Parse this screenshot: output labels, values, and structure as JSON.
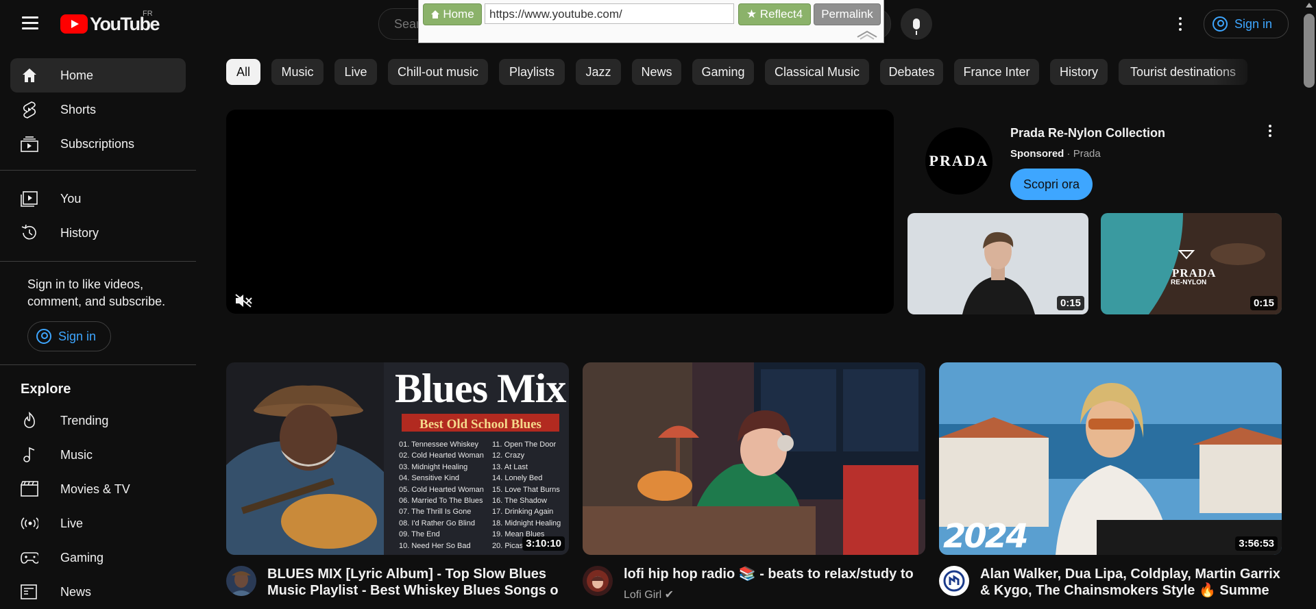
{
  "header": {
    "logo_text": "YouTube",
    "region": "FR",
    "search_placeholder": "Search",
    "signin_label": "Sign in"
  },
  "bookmarklet": {
    "home_label": "Home",
    "url_value": "https://www.youtube.com/",
    "reflect_label": "★ Reflect4",
    "permalink_label": "Permalink"
  },
  "sidebar": {
    "items": [
      {
        "label": "Home",
        "icon": "home-icon"
      },
      {
        "label": "Shorts",
        "icon": "shorts-icon"
      },
      {
        "label": "Subscriptions",
        "icon": "subscriptions-icon"
      },
      {
        "label": "You",
        "icon": "you-icon"
      },
      {
        "label": "History",
        "icon": "history-icon"
      }
    ],
    "signin_message": "Sign in to like videos, comment, and subscribe.",
    "signin_label": "Sign in",
    "explore_title": "Explore",
    "explore": [
      {
        "label": "Trending",
        "icon": "trending-icon"
      },
      {
        "label": "Music",
        "icon": "music-icon"
      },
      {
        "label": "Movies & TV",
        "icon": "movies-icon"
      },
      {
        "label": "Live",
        "icon": "live-icon"
      },
      {
        "label": "Gaming",
        "icon": "gaming-icon"
      },
      {
        "label": "News",
        "icon": "news-icon"
      }
    ]
  },
  "chips": [
    "All",
    "Music",
    "Live",
    "Chill-out music",
    "Playlists",
    "Jazz",
    "News",
    "Gaming",
    "Classical Music",
    "Debates",
    "France Inter",
    "History",
    "Tourist destinations"
  ],
  "ad": {
    "avatar_text": "PRADA",
    "title": "Prada Re-Nylon Collection",
    "sponsored": "Sponsored",
    "dot": "·",
    "advertiser": "Prada",
    "cta": "Scopri ora",
    "thumb1_duration": "0:15",
    "thumb2_duration": "0:15",
    "thumb2_logo": "PRADA",
    "thumb2_logo_sub": "RE-NYLON"
  },
  "videos": [
    {
      "title": "BLUES MIX [Lyric Album] - Top Slow Blues Music Playlist - Best Whiskey Blues Songs o",
      "duration": "3:10:10",
      "channel": "",
      "thumb_heading": "Blues Mix",
      "thumb_banner": "Best Old School Blues",
      "tracks_left": [
        "01. Tennessee Whiskey",
        "02. Cold Hearted Woman",
        "03. Midnight Healing",
        "04. Sensitive Kind",
        "05. Cold Hearted Woman",
        "06. Married To The Blues",
        "07. The Thrill Is Gone",
        "08. I'd Rather Go Blind",
        "09. The End",
        "10. Need Her So Bad"
      ],
      "tracks_right": [
        "11. Open The Door",
        "12. Crazy",
        "13. At Last",
        "14. Lonely Bed",
        "15. Love That Burns",
        "16. The Shadow",
        "17. Drinking Again",
        "18. Midnight Healing",
        "19. Mean Blues",
        "20. Picas"
      ]
    },
    {
      "title": "lofi hip hop radio 📚 - beats to relax/study to",
      "duration": "",
      "channel": "Lofi Girl ✔"
    },
    {
      "title": "Alan Walker, Dua Lipa, Coldplay, Martin Garrix & Kygo, The Chainsmokers Style 🔥 Summe",
      "duration": "3:56:53",
      "channel": "",
      "thumb_year": "2024"
    }
  ],
  "colors": {
    "background": "#0f0f0f",
    "accent_blue": "#3ea6ff",
    "brand_red": "#ff0000",
    "chip_bg": "#272727"
  }
}
